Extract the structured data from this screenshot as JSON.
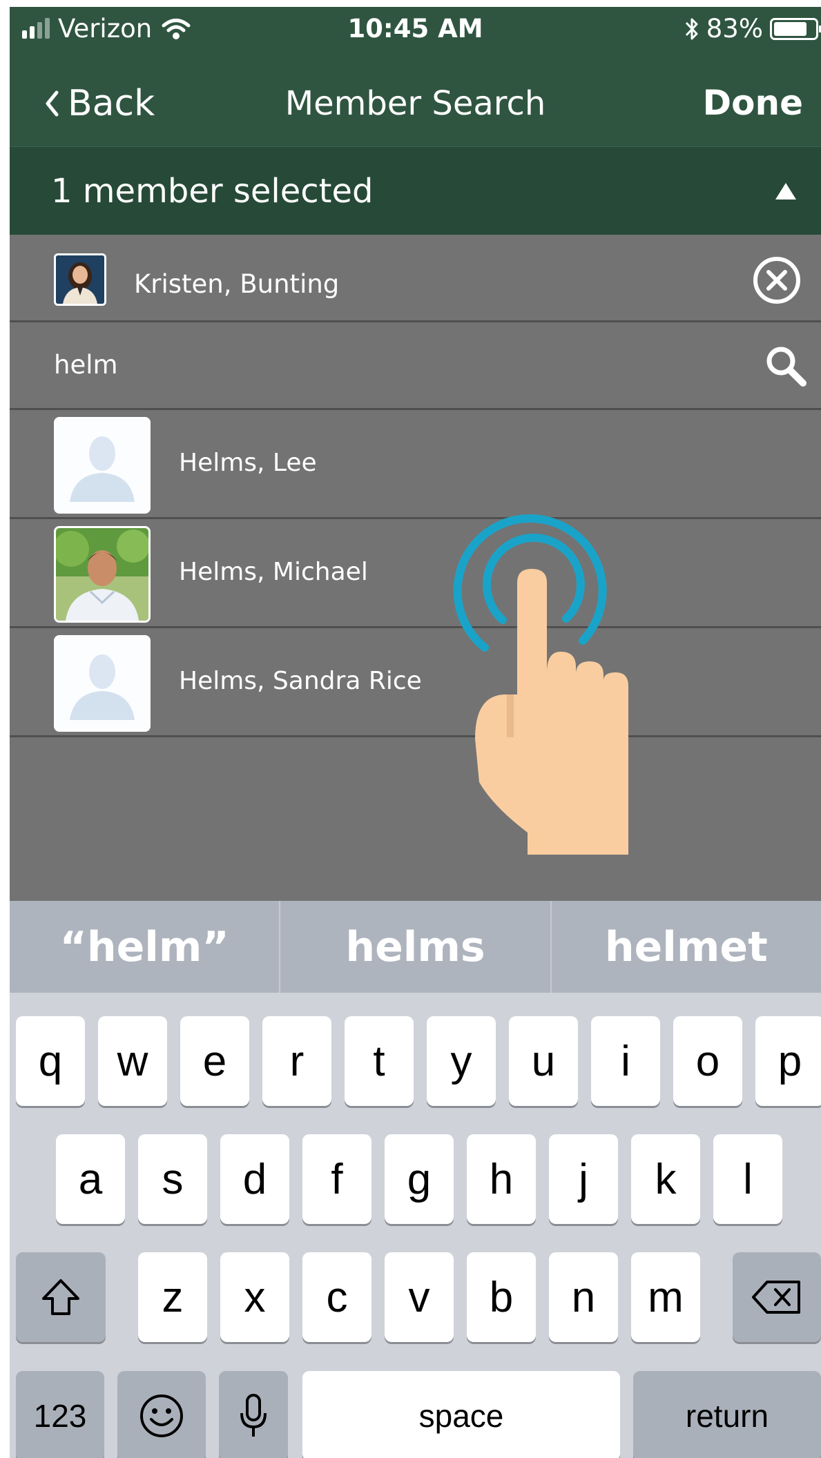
{
  "status_bar": {
    "carrier": "Verizon",
    "time": "10:45 AM",
    "battery_percent": "83%",
    "battery_level": 0.83,
    "signal_icon": "cellular-signal-icon",
    "wifi_icon": "wifi-icon",
    "bluetooth_icon": "bluetooth-icon"
  },
  "nav": {
    "back_label": "Back",
    "title": "Member Search",
    "done_label": "Done"
  },
  "selection": {
    "summary": "1 member selected",
    "toggle_icon": "triangle-up-icon",
    "chips": [
      {
        "name": "Kristen, Bunting",
        "remove_icon": "close-circle-icon"
      }
    ]
  },
  "search": {
    "value": "helm",
    "icon": "search-icon"
  },
  "results": [
    {
      "name": "Helms, Lee",
      "avatar": "placeholder"
    },
    {
      "name": "Helms, Michael",
      "avatar": "photo"
    },
    {
      "name": "Helms, Sandra Rice",
      "avatar": "placeholder"
    }
  ],
  "keyboard": {
    "suggestions": [
      "“helm”",
      "helms",
      "helmet"
    ],
    "row1": [
      "q",
      "w",
      "e",
      "r",
      "t",
      "y",
      "u",
      "i",
      "o",
      "p"
    ],
    "row2": [
      "a",
      "s",
      "d",
      "f",
      "g",
      "h",
      "j",
      "k",
      "l"
    ],
    "row3": [
      "z",
      "x",
      "c",
      "v",
      "b",
      "n",
      "m"
    ],
    "numbers_label": "123",
    "space_label": "space",
    "return_label": "return",
    "shift_icon": "shift-icon",
    "delete_icon": "delete-icon",
    "emoji_icon": "emoji-icon",
    "mic_icon": "microphone-icon"
  },
  "colors": {
    "header_green": "#2f5541",
    "selected_bar_green": "#264a37",
    "list_gray": "#737373",
    "tap_ring": "#1aa3c9",
    "hand": "#f9cda0"
  }
}
